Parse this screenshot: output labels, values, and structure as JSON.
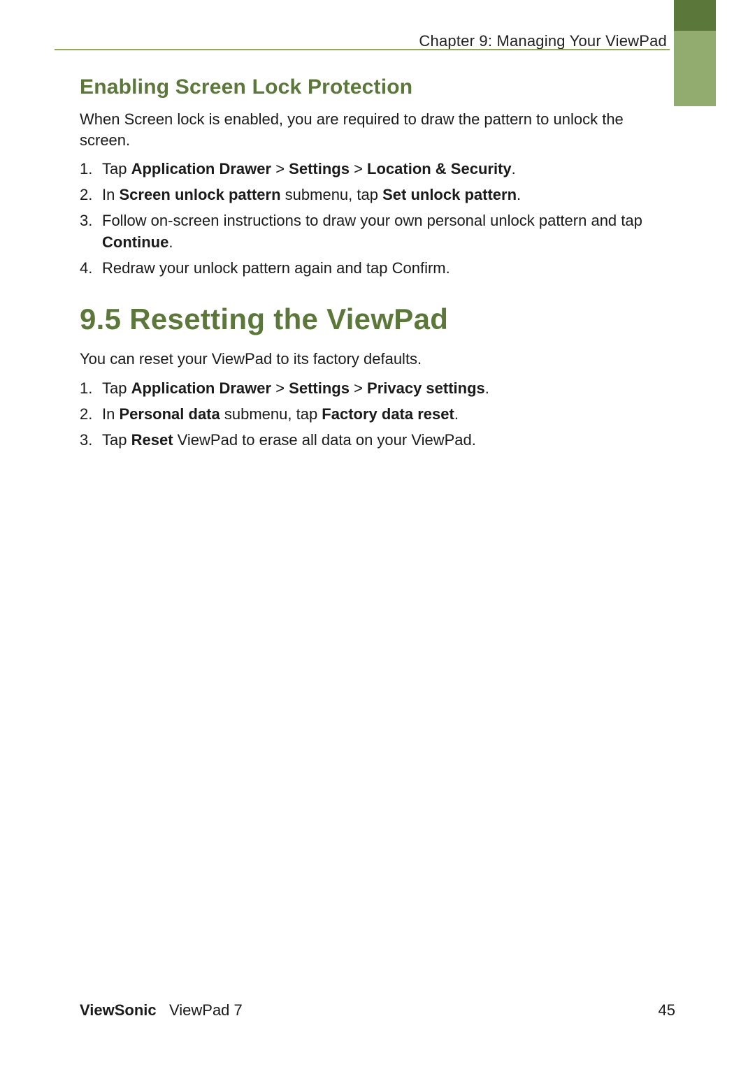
{
  "header": {
    "chapter": "Chapter 9: Managing Your ViewPad"
  },
  "section1": {
    "heading": "Enabling Screen Lock Protection",
    "intro": "When Screen lock is enabled, you are required to draw the pattern to unlock the screen.",
    "steps": [
      {
        "pre": "Tap ",
        "b1": "Application Drawer",
        "mid1": " > ",
        "b2": "Settings",
        "mid2": " > ",
        "b3": "Location & Security",
        "post": "."
      },
      {
        "pre": "In ",
        "b1": "Screen unlock pattern",
        "mid1": " submenu, tap ",
        "b2": "Set unlock pattern",
        "post": "."
      },
      {
        "pre": "Follow on-screen instructions to draw your own personal unlock pattern and tap ",
        "b1": "Continue",
        "post": "."
      },
      {
        "pre": "Redraw your unlock pattern again and tap Confirm."
      }
    ]
  },
  "section2": {
    "heading": "9.5 Resetting the ViewPad",
    "intro": "You can reset your ViewPad to its factory defaults.",
    "steps": [
      {
        "pre": "Tap ",
        "b1": "Application Drawer",
        "mid1": " > ",
        "b2": "Settings",
        "mid2": " > ",
        "b3": "Privacy settings",
        "post": "."
      },
      {
        "pre": "In ",
        "b1": "Personal data",
        "mid1": " submenu, tap ",
        "b2": "Factory data reset",
        "post": "."
      },
      {
        "pre": "Tap ",
        "b1": "Reset",
        "mid1": " ViewPad to erase all data on your ViewPad."
      }
    ]
  },
  "footer": {
    "brand_bold": "ViewSonic",
    "brand_rest": "ViewPad 7",
    "page_number": "45"
  }
}
